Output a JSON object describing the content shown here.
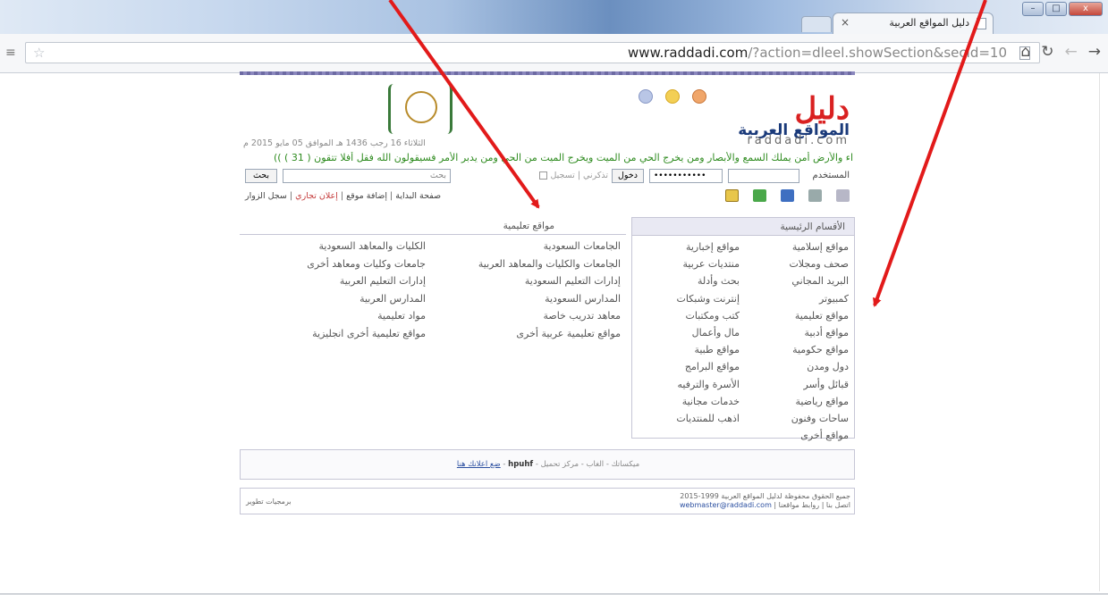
{
  "browser": {
    "tab_title": "دليل المواقع العربية",
    "tab_close": "×",
    "url_host": "www.raddadi.com",
    "url_path": "/?action=dleel.showSection&secid=10",
    "win_min": "–",
    "win_max": "□",
    "win_close": "x"
  },
  "site": {
    "logo_word": "دليل",
    "logo_sub": "المواقع العربية",
    "logo_latin": "raddadi.com",
    "date_line": "الثلاثاء 16 رجب 1436 هـ الموافق 05 مايو 2015 م",
    "verse": "اء والأرض أمن يملك السمع والأبصار ومن يخرج الحي من الميت ويخرج الميت من الحي ومن يدبر الأمر فسيقولون الله فقل أفلا تتقون ( 31 ) ))"
  },
  "login": {
    "username_label": "المستخدم",
    "password_value": "•••••••••••",
    "login_button": "دخول",
    "remember_text": "تذكرني | تسجيل",
    "search_placeholder": "بحث",
    "search_button": "بحث"
  },
  "nav": {
    "home": "صفحة البداية",
    "sep1": "|",
    "add_site": "إضافة موقع",
    "sep2": "|",
    "ads": "إعلان تجاري",
    "sep3": "|",
    "guestbook": "سجل الزوار"
  },
  "sidebar": {
    "title": "الأقسام الرئيسية",
    "col1": [
      "مواقع إسلامية",
      "صحف ومجلات",
      "البريد المجاني",
      "كمبيوتر",
      "مواقع تعليمية",
      "مواقع أدبية",
      "مواقع حكومية",
      "دول ومدن",
      "قبائل وأسر",
      "مواقع رياضية",
      "ساحات وفنون",
      "مواقع أخرى"
    ],
    "col2": [
      "مواقع إخبارية",
      "منتديات عربية",
      "بحث وأدلة",
      "إنترنت وشبكات",
      "كتب ومكتبات",
      "مال وأعمال",
      "مواقع طبية",
      "مواقع البرامج",
      "الأسرة والترفيه",
      "خدمات مجانية",
      "اذهب للمنتديات"
    ]
  },
  "main": {
    "title": "مواقع تعليمية",
    "col1": [
      "الجامعات السعودية",
      "الجامعات والكليات والمعاهد العربية",
      "إدارات التعليم السعودية",
      "المدارس السعودية",
      "معاهد تدريب خاصة",
      "مواقع تعليمية عربية أخرى"
    ],
    "col2": [
      "الكليات والمعاهد السعودية",
      "جامعات وكليات ومعاهد أخرى",
      "إدارات التعليم العربية",
      "المدارس العربية",
      "مواد تعليمية",
      "مواقع تعليمية أخرى انجليزية"
    ]
  },
  "footer": {
    "links_prefix": "ميكساتك - الغاب - مركز تحميل -",
    "hpuhf": "hpuhf",
    "dash": "-",
    "ad_link": "ضع اعلانك هنا",
    "copyright_line1": "جميع الحقوق محفوظة لدليل المواقع العربية 1999-2015",
    "copyright_contact": "اتصل بنا | روابط مواقعنا |",
    "email": "webmaster@raddadi.com",
    "developer": "برمجيات تطوير"
  },
  "colors": {
    "logo_red": "#d92121",
    "verse_green": "#2e8b1f",
    "arrow_red": "#e21a1a"
  }
}
